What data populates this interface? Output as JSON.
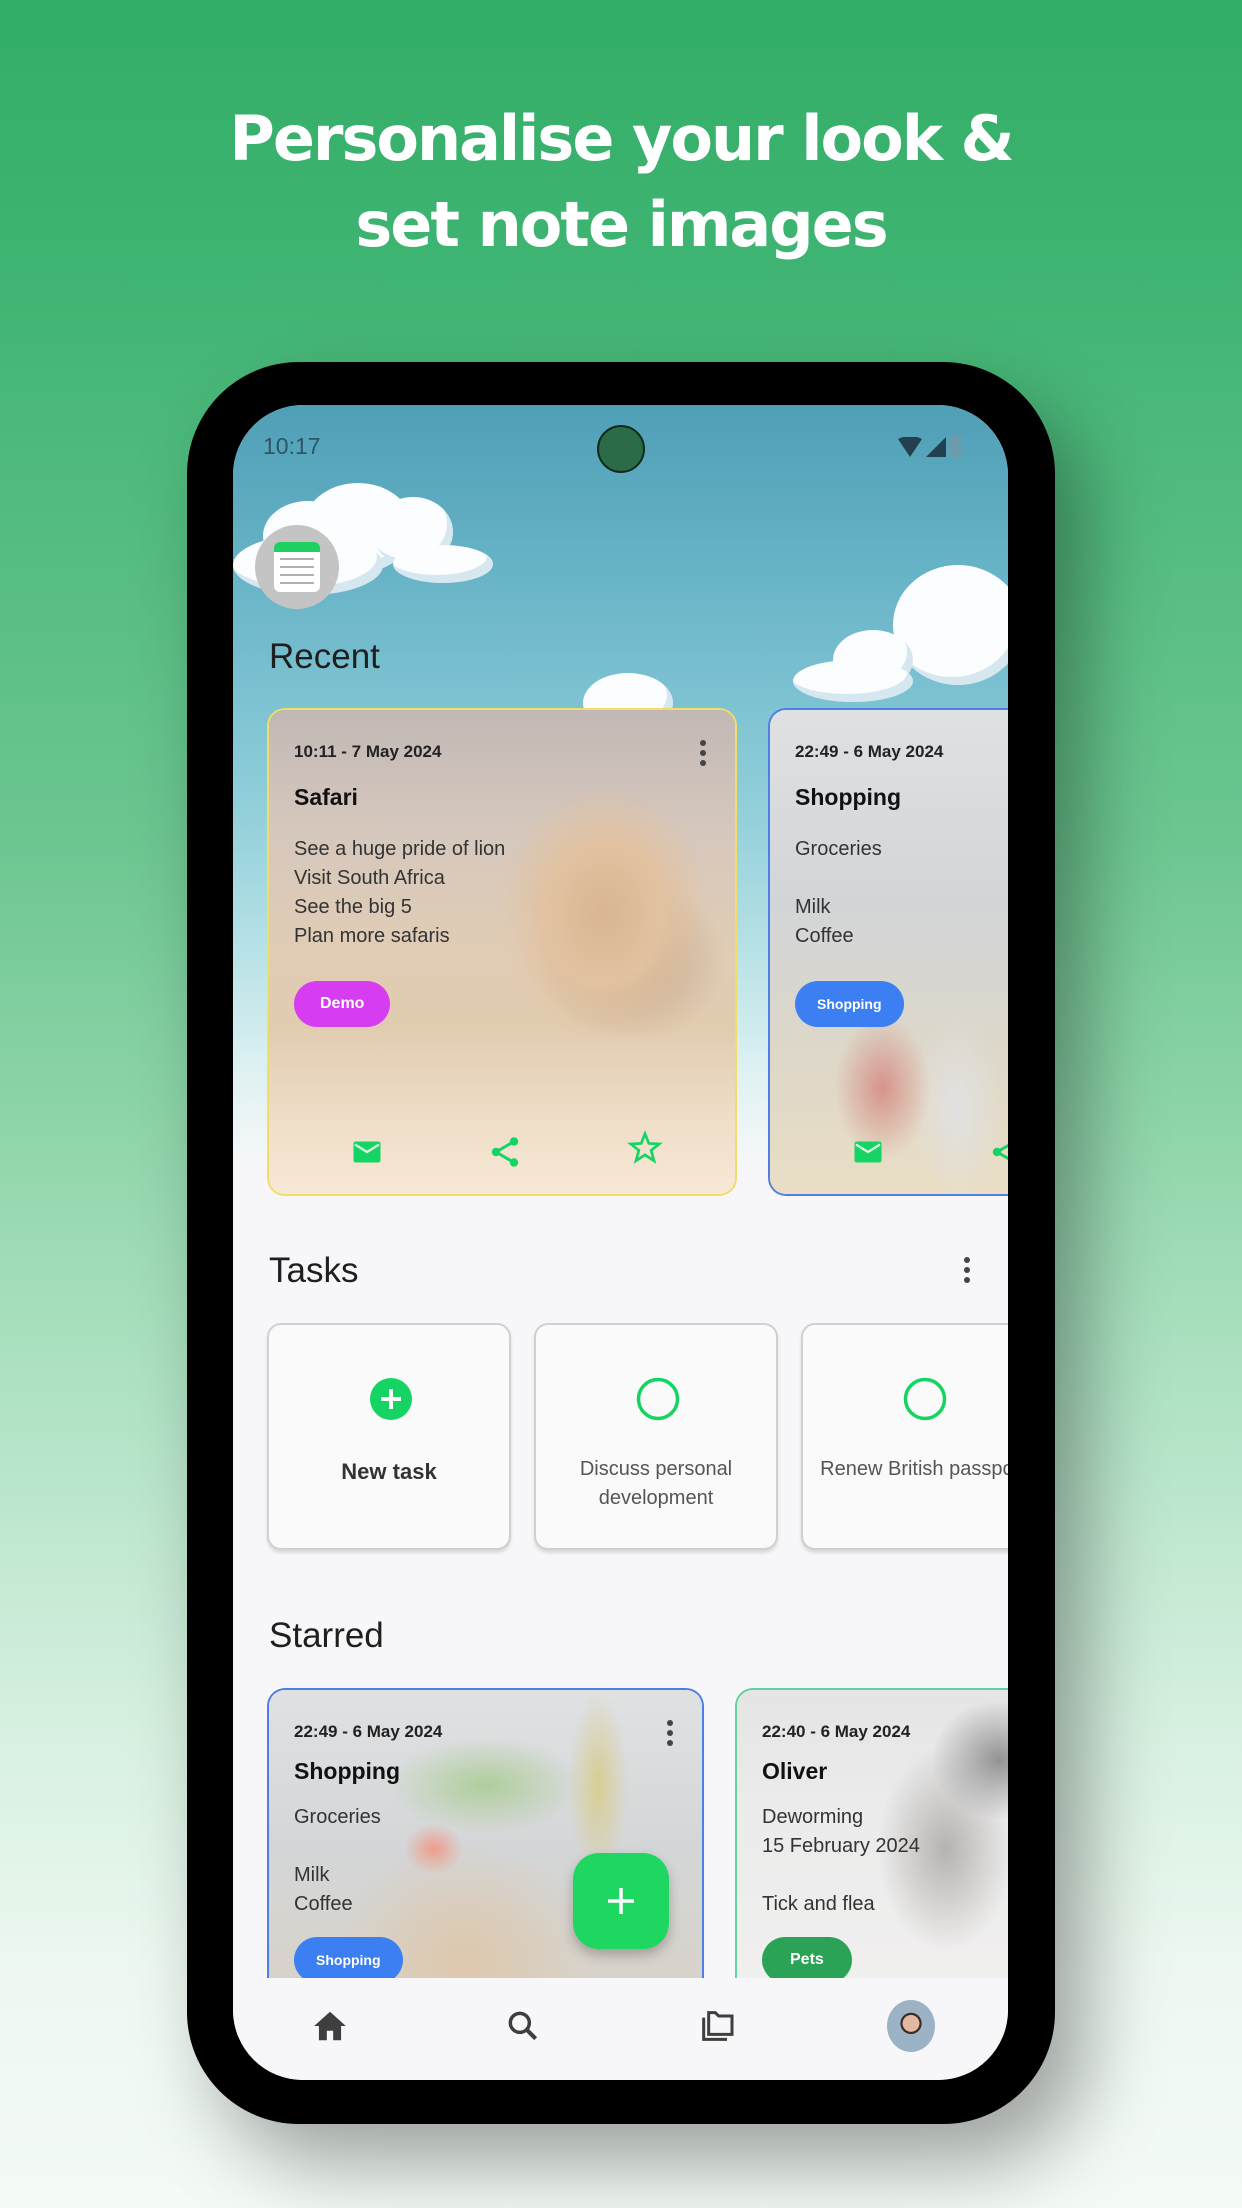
{
  "headline": {
    "line1": "Personalise your look &",
    "line2": "set note images"
  },
  "status_bar": {
    "time": "10:17",
    "icons": [
      "wifi-icon",
      "signal-icon",
      "battery-icon"
    ]
  },
  "app": {
    "logo_icon": "notes-app-icon"
  },
  "recent": {
    "title": "Recent",
    "notes": [
      {
        "date": "10:11 - 7 May 2024",
        "title": "Safari",
        "body": [
          "See a huge pride of lion",
          "Visit South Africa",
          "See the big 5",
          "Plan more safaris"
        ],
        "tag": "Demo",
        "tag_color": "#d63cf0",
        "border_color": "#f0dd6a",
        "image": "lion-in-grass",
        "actions": [
          "email-icon",
          "share-icon",
          "star-outline-icon"
        ]
      },
      {
        "date": "22:49 - 6 May 2024",
        "title": "Shopping",
        "body": [
          "Groceries",
          "",
          "Milk",
          "Coffee"
        ],
        "tag": "Shopping",
        "tag_color": "#3b7ff2",
        "border_color": "#4f7fe6",
        "image": "grocery-bag",
        "actions": [
          "email-icon",
          "share-icon"
        ]
      }
    ]
  },
  "tasks": {
    "title": "Tasks",
    "items": [
      {
        "label": "New task",
        "type": "new"
      },
      {
        "label": "Discuss personal development",
        "type": "task",
        "done": false
      },
      {
        "label": "Renew British passport",
        "type": "task",
        "done": false
      }
    ]
  },
  "starred": {
    "title": "Starred",
    "notes": [
      {
        "date": "22:49 - 6 May 2024",
        "title": "Shopping",
        "body": [
          "Groceries",
          "",
          "Milk",
          "Coffee"
        ],
        "tag": "Shopping",
        "tag_color": "#3b7ff2",
        "border_color": "#4f7fe6",
        "image": "grocery-bag"
      },
      {
        "date": "22:40 - 6 May 2024",
        "title": "Oliver",
        "body": [
          "Deworming",
          "15 February 2024",
          "",
          "Tick and flea"
        ],
        "tag": "Pets",
        "tag_color": "#2aa356",
        "border_color": "#5fd3a0",
        "image": "dog"
      }
    ]
  },
  "fab": {
    "icon": "plus-icon"
  },
  "bottom_nav": {
    "items": [
      {
        "name": "home",
        "icon": "home-icon",
        "active": true
      },
      {
        "name": "search",
        "icon": "search-icon"
      },
      {
        "name": "folders",
        "icon": "folders-icon"
      },
      {
        "name": "profile",
        "icon": "avatar"
      }
    ]
  },
  "colors": {
    "accent": "#1ed760",
    "background_top": "#32ae68",
    "background_bottom": "#f4faf6"
  }
}
